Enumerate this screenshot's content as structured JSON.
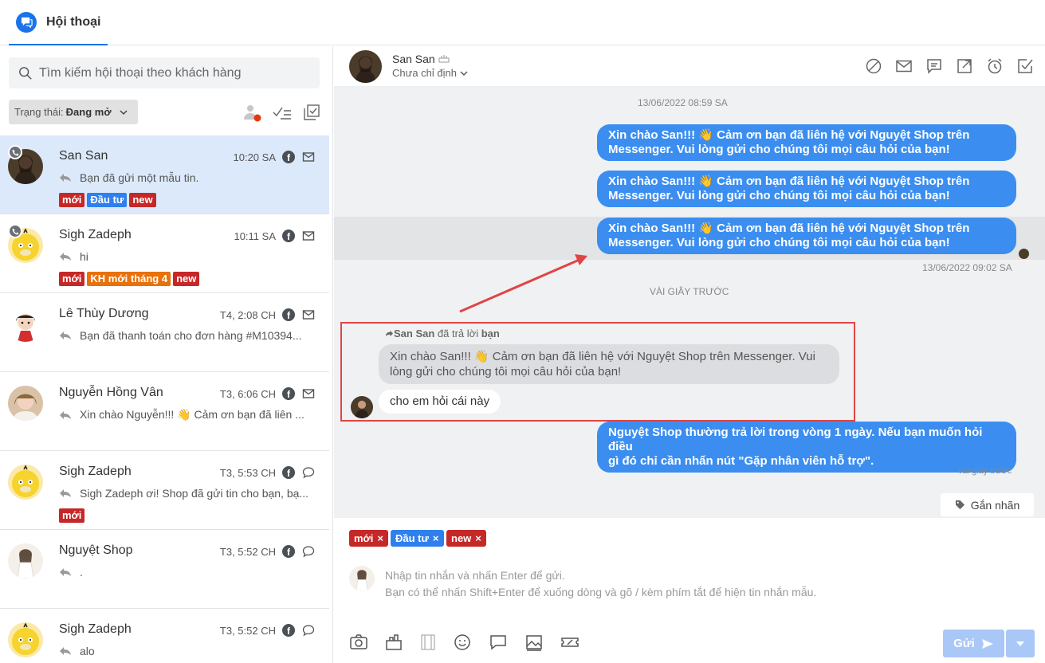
{
  "app": {
    "tab_label": "Hội thoại"
  },
  "sidebar": {
    "search_placeholder": "Tìm kiếm hội thoại theo khách hàng",
    "filter": {
      "prefix": "Trạng thái:",
      "value": "Đang mở"
    },
    "conversations": [
      {
        "name": "San San",
        "time": "10:20 SA",
        "channel_icon": "mail-icon",
        "message": "Bạn đã gửi một mẫu tin.",
        "tags": [
          {
            "label": "mới",
            "color": "#c62828"
          },
          {
            "label": "Đầu tư",
            "color": "#2f80ed"
          },
          {
            "label": "new",
            "color": "#c62828"
          }
        ]
      },
      {
        "name": "Sigh Zadeph",
        "time": "10:11 SA",
        "channel_icon": "mail-icon",
        "message": "hi",
        "tags": [
          {
            "label": "mới",
            "color": "#c62828"
          },
          {
            "label": "KH mới tháng 4",
            "color": "#e8710a"
          },
          {
            "label": "new",
            "color": "#c62828"
          }
        ]
      },
      {
        "name": "Lê Thùy Dương",
        "time": "T4, 2:08 CH",
        "channel_icon": "mail-icon",
        "message": "Bạn đã thanh toán cho đơn hàng #M10394...",
        "tags": []
      },
      {
        "name": "Nguyễn Hồng Vân",
        "time": "T3, 6:06 CH",
        "channel_icon": "mail-icon",
        "message": "Xin chào Nguyễn!!! 👋 Cảm ơn bạn đã liên ...",
        "tags": []
      },
      {
        "name": "Sigh Zadeph",
        "time": "T3, 5:53 CH",
        "channel_icon": "comment-icon",
        "message": "Sigh Zadeph ơi! Shop đã gửi tin cho bạn, bạ...",
        "tags": [
          {
            "label": "mới",
            "color": "#c62828"
          }
        ]
      },
      {
        "name": "Nguyệt Shop",
        "time": "T3, 5:52 CH",
        "channel_icon": "comment-icon",
        "message": ".",
        "tags": []
      },
      {
        "name": "Sigh Zadeph",
        "time": "T3, 5:52 CH",
        "channel_icon": "comment-icon",
        "message": "alo",
        "tags": []
      }
    ]
  },
  "chat": {
    "contact_name": "San San",
    "assignee": "Chưa chỉ định",
    "date_stamp": "13/06/2022 08:59 SA",
    "greeting": "Xin chào San!!! 👋 Cảm ơn bạn đã liên hệ với Nguyệt Shop trên Messenger. Vui lòng gửi cho chúng tôi mọi câu hỏi của bạn!",
    "greeting_line1": "Xin chào San!!! 👋 Cảm ơn bạn đã liên hệ với Nguyệt Shop trên",
    "greeting_line2": "Messenger. Vui lòng gửi cho chúng tôi mọi câu hỏi của bạn!",
    "sent_time": "13/06/2022 09:02 SA",
    "separator": "VÀI GIÂY TRƯỚC",
    "reply_header_name": "San San",
    "reply_header_text": "đã trả lời",
    "reply_header_target": "bạn",
    "quoted_line1": "Xin chào San!!! 👋 Cảm ơn bạn đã liên hệ với Nguyệt Shop trên Messenger. Vui",
    "quoted_line2": "lòng gửi cho chúng tôi mọi câu hỏi của bạn!",
    "customer_message": "cho em hỏi cái này",
    "auto_line1": "Nguyệt Shop thường trả lời trong vòng 1 ngày. Nếu bạn muốn hỏi điều",
    "auto_line2": "gì đó chỉ cần nhấn nút \"Gặp nhân viên hỗ trợ\".",
    "auto_time": "vài giây trước",
    "tag_button": "Gắn nhãn"
  },
  "composer": {
    "tags": [
      {
        "label": "mới",
        "color": "#c62828"
      },
      {
        "label": "Đầu tư",
        "color": "#2f80ed"
      },
      {
        "label": "new",
        "color": "#c62828"
      }
    ],
    "placeholder_line1": "Nhập tin nhắn và nhấn Enter để gửi.",
    "placeholder_line2": "Bạn có thể nhấn Shift+Enter để xuống dòng và gõ / kèm phím tắt để hiện tin nhắn mẫu.",
    "send_label": "Gửi",
    "remove_glyph": "×"
  },
  "colors": {
    "accent": "#1a73e8",
    "bubble": "#3b8ef0",
    "highlight_border": "#e04545"
  }
}
